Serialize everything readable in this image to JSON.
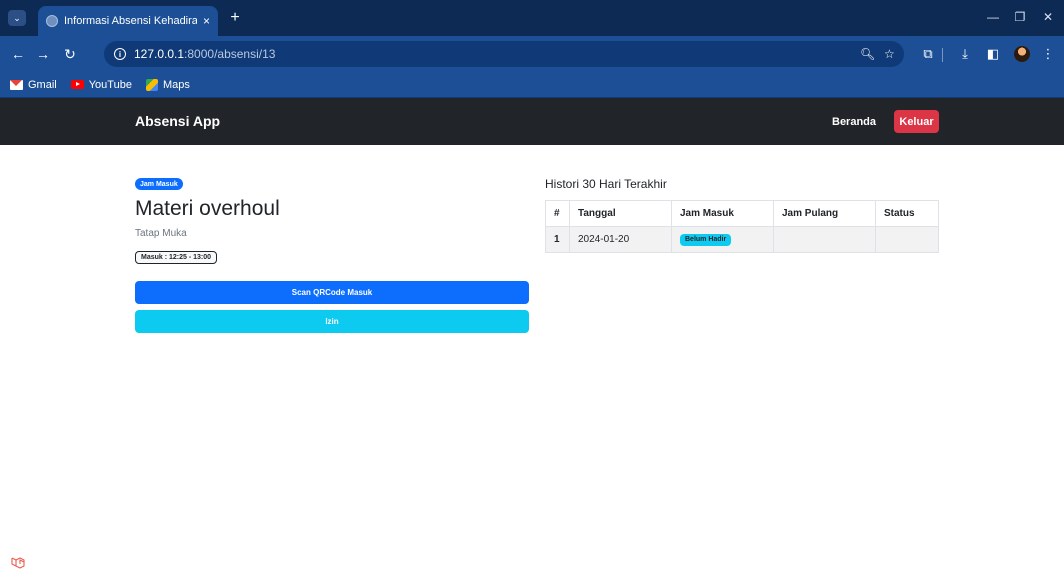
{
  "browser": {
    "tab_title": "Informasi Absensi Kehadiran | A",
    "tab_close": "×",
    "new_tab": "+",
    "url_host": "127.0.0.1",
    "url_path": ":8000/absensi/13",
    "bookmarks": [
      {
        "label": "Gmail",
        "icon": "gmail-icon"
      },
      {
        "label": "YouTube",
        "icon": "youtube-icon"
      },
      {
        "label": "Maps",
        "icon": "maps-icon"
      }
    ]
  },
  "navbar": {
    "brand": "Absensi App",
    "home_label": "Beranda",
    "logout_label": "Keluar"
  },
  "session": {
    "badge": "Jam Masuk",
    "title": "Materi overhoul",
    "subtitle": "Tatap Muka",
    "time_badge": "Masuk : 12:25 - 13:00",
    "scan_button": "Scan QRCode Masuk",
    "permit_button": "Izin"
  },
  "history": {
    "title": "Histori 30 Hari Terakhir",
    "columns": [
      "#",
      "Tanggal",
      "Jam Masuk",
      "Jam Pulang",
      "Status"
    ],
    "rows": [
      {
        "no": "1",
        "date": "2024-01-20",
        "check_in": "Belum Hadir",
        "check_out": "",
        "status": ""
      }
    ]
  },
  "colors": {
    "primary": "#0d6efd",
    "info": "#0dcaf0",
    "danger": "#dc3545",
    "navbar": "#212529",
    "chrome": "#1c4f96"
  }
}
